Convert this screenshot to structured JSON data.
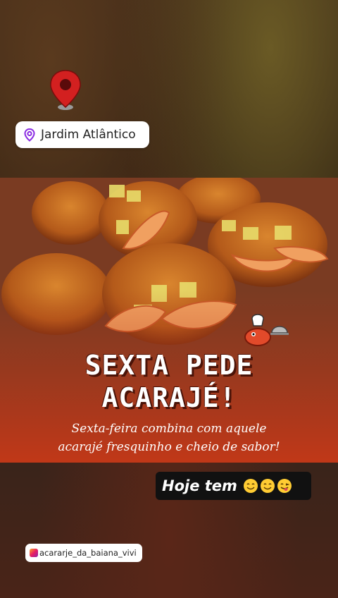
{
  "story": {
    "location": {
      "label": "Jardim Atlântico",
      "icon": "map-pin-icon"
    },
    "pin_sticker": {
      "icon": "map-marker-icon",
      "color": "#d32020"
    },
    "post": {
      "headline_line1": "SEXTA PEDE",
      "headline_line2": "ACARAJÉ!",
      "subtext_line1": "Sexta-feira combina com aquele",
      "subtext_line2": "acarajé fresquinho e cheio de sabor!",
      "mascot_icon": "shrimp-chef-icon",
      "accent_color": "#b0361c"
    },
    "hoje_tem": {
      "text": "Hoje tem",
      "emojis": [
        "smiling-face-icon",
        "smiling-face-icon",
        "tongue-face-icon"
      ]
    },
    "mention": {
      "handle": "acararje_da_baiana_vivi",
      "icon": "instagram-icon"
    }
  }
}
